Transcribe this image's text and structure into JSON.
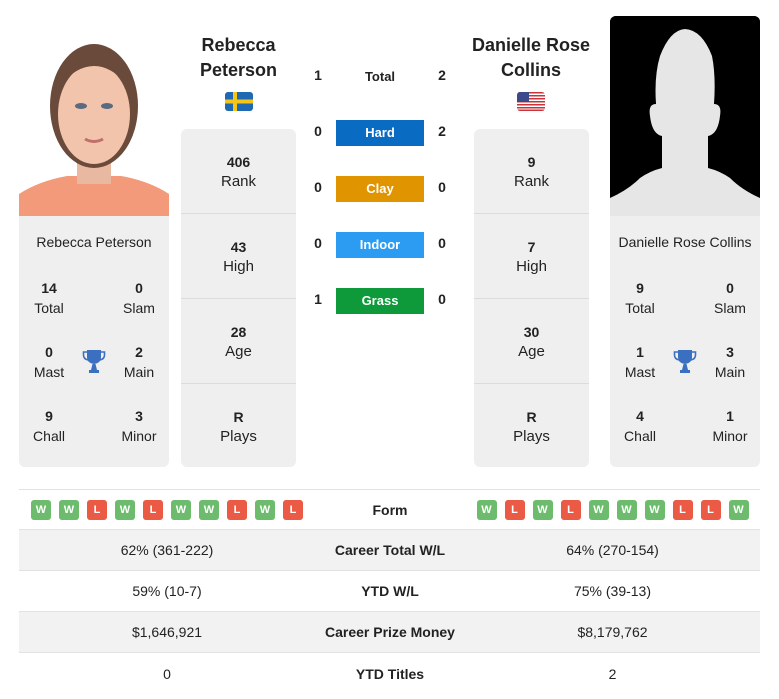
{
  "player1": {
    "name": "Rebecca Peterson",
    "name_line1": "Rebecca",
    "name_line2": "Peterson",
    "country_flag": "sweden-flag",
    "photo": "player-photo",
    "titles": {
      "total": {
        "value": "14",
        "label": "Total"
      },
      "slam": {
        "value": "0",
        "label": "Slam"
      },
      "mast": {
        "value": "0",
        "label": "Mast"
      },
      "main": {
        "value": "2",
        "label": "Main"
      },
      "chall": {
        "value": "9",
        "label": "Chall"
      },
      "minor": {
        "value": "3",
        "label": "Minor"
      }
    },
    "stats": {
      "rank": {
        "value": "406",
        "label": "Rank"
      },
      "high": {
        "value": "43",
        "label": "High"
      },
      "age": {
        "value": "28",
        "label": "Age"
      },
      "plays": {
        "value": "R",
        "label": "Plays"
      }
    },
    "form": [
      "W",
      "W",
      "L",
      "W",
      "L",
      "W",
      "W",
      "L",
      "W",
      "L"
    ]
  },
  "player2": {
    "name": "Danielle Rose Collins",
    "name_line1": "Danielle Rose",
    "name_line2": "Collins",
    "country_flag": "usa-flag",
    "photo": "placeholder-silhouette",
    "titles": {
      "total": {
        "value": "9",
        "label": "Total"
      },
      "slam": {
        "value": "0",
        "label": "Slam"
      },
      "mast": {
        "value": "1",
        "label": "Mast"
      },
      "main": {
        "value": "3",
        "label": "Main"
      },
      "chall": {
        "value": "4",
        "label": "Chall"
      },
      "minor": {
        "value": "1",
        "label": "Minor"
      }
    },
    "stats": {
      "rank": {
        "value": "9",
        "label": "Rank"
      },
      "high": {
        "value": "7",
        "label": "High"
      },
      "age": {
        "value": "30",
        "label": "Age"
      },
      "plays": {
        "value": "R",
        "label": "Plays"
      }
    },
    "form": [
      "W",
      "L",
      "W",
      "L",
      "W",
      "W",
      "W",
      "L",
      "L",
      "W"
    ]
  },
  "h2h": {
    "total": {
      "label": "Total",
      "p1": "1",
      "p2": "2"
    },
    "surfaces": [
      {
        "label": "Hard",
        "p1": "0",
        "p2": "2",
        "color": "#0a6bc2"
      },
      {
        "label": "Clay",
        "p1": "0",
        "p2": "0",
        "color": "#e09400"
      },
      {
        "label": "Indoor",
        "p1": "0",
        "p2": "0",
        "color": "#2b9cf2"
      },
      {
        "label": "Grass",
        "p1": "1",
        "p2": "0",
        "color": "#0e9a3a"
      }
    ]
  },
  "comparison": {
    "form_label": "Form",
    "rows": [
      {
        "label": "Career Total W/L",
        "p1": "62% (361-222)",
        "p2": "64% (270-154)"
      },
      {
        "label": "YTD W/L",
        "p1": "59% (10-7)",
        "p2": "75% (39-13)"
      },
      {
        "label": "Career Prize Money",
        "p1": "$1,646,921",
        "p2": "$8,179,762"
      },
      {
        "label": "YTD Titles",
        "p1": "0",
        "p2": "2"
      }
    ]
  },
  "colors": {
    "win": "#6dbb6d",
    "loss": "#ea5a45",
    "trophy": "#3b6fbf"
  }
}
